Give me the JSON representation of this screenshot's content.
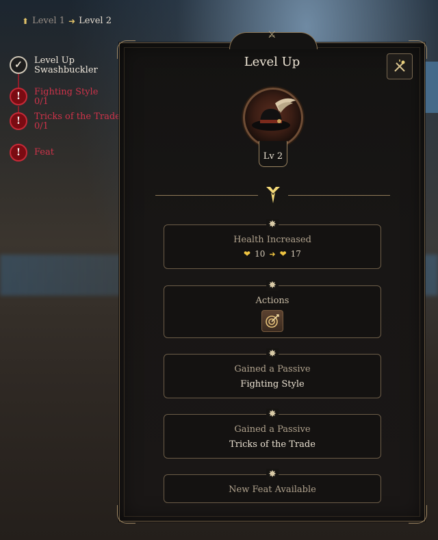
{
  "breadcrumb": {
    "from_level": "Level 1",
    "to_level": "Level 2"
  },
  "steps": [
    {
      "label": "Level Up",
      "sub": "Swashbuckler",
      "status": "done"
    },
    {
      "label": "Fighting Style",
      "sub": "0/1",
      "status": "alert"
    },
    {
      "label": "Tricks of the Trade",
      "sub": "0/1",
      "status": "alert"
    },
    {
      "label": "Feat",
      "sub": "",
      "status": "alert"
    }
  ],
  "panel": {
    "title": "Level Up",
    "level_badge": "Lv 2"
  },
  "cards": {
    "health": {
      "title": "Health Increased",
      "from": "10",
      "to": "17"
    },
    "actions": {
      "title": "Actions",
      "icon": "target-arrow-icon"
    },
    "passive1": {
      "title": "Gained a Passive",
      "value": "Fighting Style"
    },
    "passive2": {
      "title": "Gained a Passive",
      "value": "Tricks of the Trade"
    },
    "feat": {
      "title": "New Feat Available"
    }
  },
  "colors": {
    "accent_gold": "#f0c541",
    "alert_red": "#d0334a",
    "frame": "#9c8562"
  }
}
